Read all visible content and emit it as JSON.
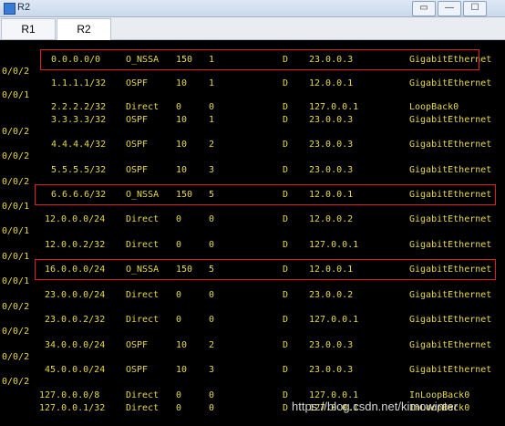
{
  "window": {
    "title": "R2",
    "buttons": [
      "▭",
      "—",
      "☐"
    ]
  },
  "tabs": [
    {
      "label": "R1"
    },
    {
      "label": "R2",
      "active": true
    }
  ],
  "routes": [
    {
      "dest": "0.0.0.0/0",
      "proto": "O_NSSA",
      "pre": "150",
      "cost": "1",
      "flags": "D",
      "nexthop": "23.0.0.3",
      "iface": "GigabitEthernet",
      "cont": "0/0/2",
      "highlight": true
    },
    {
      "dest": "1.1.1.1/32",
      "proto": "OSPF",
      "pre": "10",
      "cost": "1",
      "flags": "D",
      "nexthop": "12.0.0.1",
      "iface": "GigabitEthernet",
      "cont": "0/0/1"
    },
    {
      "dest": "2.2.2.2/32",
      "proto": "Direct",
      "pre": "0",
      "cost": "0",
      "flags": "D",
      "nexthop": "127.0.0.1",
      "iface": "LoopBack0",
      "cont": ""
    },
    {
      "dest": "3.3.3.3/32",
      "proto": "OSPF",
      "pre": "10",
      "cost": "1",
      "flags": "D",
      "nexthop": "23.0.0.3",
      "iface": "GigabitEthernet",
      "cont": "0/0/2"
    },
    {
      "dest": "4.4.4.4/32",
      "proto": "OSPF",
      "pre": "10",
      "cost": "2",
      "flags": "D",
      "nexthop": "23.0.0.3",
      "iface": "GigabitEthernet",
      "cont": "0/0/2"
    },
    {
      "dest": "5.5.5.5/32",
      "proto": "OSPF",
      "pre": "10",
      "cost": "3",
      "flags": "D",
      "nexthop": "23.0.0.3",
      "iface": "GigabitEthernet",
      "cont": "0/0/2"
    },
    {
      "dest": "6.6.6.6/32",
      "proto": "O_NSSA",
      "pre": "150",
      "cost": "5",
      "flags": "D",
      "nexthop": "12.0.0.1",
      "iface": "GigabitEthernet",
      "cont": "0/0/1",
      "highlight": true
    },
    {
      "dest": "12.0.0.0/24",
      "proto": "Direct",
      "pre": "0",
      "cost": "0",
      "flags": "D",
      "nexthop": "12.0.0.2",
      "iface": "GigabitEthernet",
      "cont": "0/0/1"
    },
    {
      "dest": "12.0.0.2/32",
      "proto": "Direct",
      "pre": "0",
      "cost": "0",
      "flags": "D",
      "nexthop": "127.0.0.1",
      "iface": "GigabitEthernet",
      "cont": "0/0/1"
    },
    {
      "dest": "16.0.0.0/24",
      "proto": "O_NSSA",
      "pre": "150",
      "cost": "5",
      "flags": "D",
      "nexthop": "12.0.0.1",
      "iface": "GigabitEthernet",
      "cont": "0/0/1",
      "highlight": true
    },
    {
      "dest": "23.0.0.0/24",
      "proto": "Direct",
      "pre": "0",
      "cost": "0",
      "flags": "D",
      "nexthop": "23.0.0.2",
      "iface": "GigabitEthernet",
      "cont": "0/0/2"
    },
    {
      "dest": "23.0.0.2/32",
      "proto": "Direct",
      "pre": "0",
      "cost": "0",
      "flags": "D",
      "nexthop": "127.0.0.1",
      "iface": "GigabitEthernet",
      "cont": "0/0/2"
    },
    {
      "dest": "34.0.0.0/24",
      "proto": "OSPF",
      "pre": "10",
      "cost": "2",
      "flags": "D",
      "nexthop": "23.0.0.3",
      "iface": "GigabitEthernet",
      "cont": "0/0/2"
    },
    {
      "dest": "45.0.0.0/24",
      "proto": "OSPF",
      "pre": "10",
      "cost": "3",
      "flags": "D",
      "nexthop": "23.0.0.3",
      "iface": "GigabitEthernet",
      "cont": "0/0/2"
    },
    {
      "dest": "127.0.0.0/8",
      "proto": "Direct",
      "pre": "0",
      "cost": "0",
      "flags": "D",
      "nexthop": "127.0.0.1",
      "iface": "InLoopBack0",
      "cont": ""
    },
    {
      "dest": "127.0.0.1/32",
      "proto": "Direct",
      "pre": "0",
      "cost": "0",
      "flags": "D",
      "nexthop": "127.0.0.1",
      "iface": "InLoopBack0",
      "cont": ""
    }
  ],
  "watermark": "https://blog.csdn.net/kimowinter"
}
